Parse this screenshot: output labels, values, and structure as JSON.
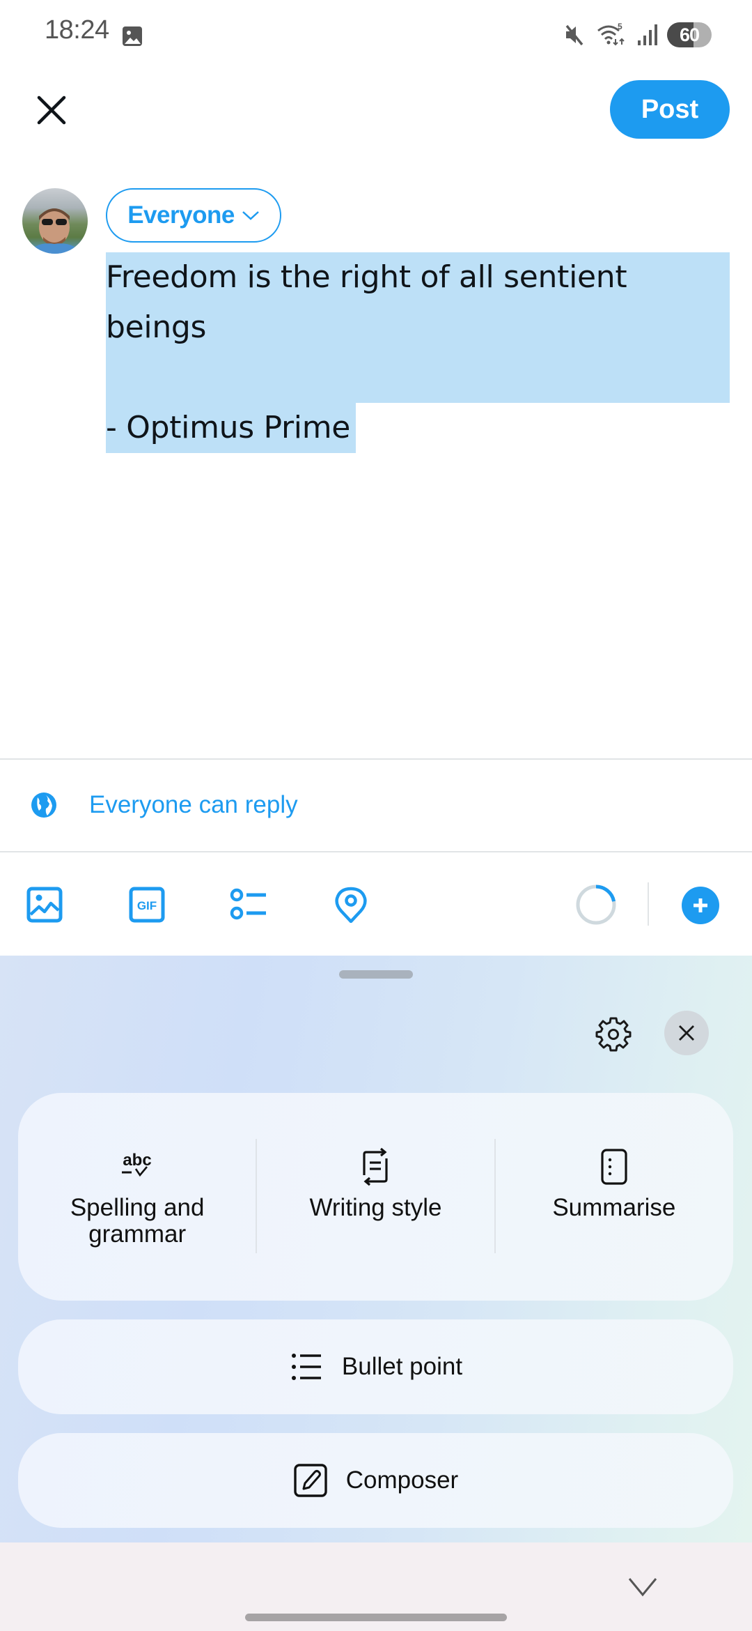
{
  "status_bar": {
    "time": "18:24",
    "notification_icons": [
      "gallery-icon"
    ],
    "system_icons": [
      "mute-icon",
      "wifi-6-icon",
      "signal-icon"
    ],
    "battery_percent": 60,
    "battery_label": "60"
  },
  "top_bar": {
    "close_icon": "close-icon",
    "post_label": "Post",
    "accent_color": "#1d9bf0"
  },
  "composer": {
    "audience_label": "Everyone",
    "text_lines": [
      "Freedom is the right of all sentient",
      "beings",
      "",
      "- Optimus Prime"
    ],
    "selected": true,
    "selection_color": "#bde0f7"
  },
  "reply_settings": {
    "icon": "globe-icon",
    "label": "Everyone can reply"
  },
  "toolbar": {
    "items": [
      {
        "name": "media",
        "icon": "image-icon"
      },
      {
        "name": "gif",
        "icon": "gif-icon",
        "glyph": "GIF"
      },
      {
        "name": "poll",
        "icon": "poll-icon"
      },
      {
        "name": "location",
        "icon": "location-pin-icon"
      }
    ],
    "character_progress": 0.22,
    "add_icon": "plus-icon"
  },
  "ai_panel": {
    "settings_icon": "gear-icon",
    "close_icon": "close-icon",
    "tools": [
      {
        "icon": "spell-check-icon",
        "glyph": "abc",
        "label": "Spelling and grammar"
      },
      {
        "icon": "writing-style-icon",
        "label": "Writing style"
      },
      {
        "icon": "summarise-icon",
        "label": "Summarise"
      }
    ],
    "actions": [
      {
        "icon": "bullet-list-icon",
        "label": "Bullet point"
      },
      {
        "icon": "compose-pencil-icon",
        "label": "Composer"
      }
    ],
    "collapse_icon": "chevron-down-icon"
  }
}
